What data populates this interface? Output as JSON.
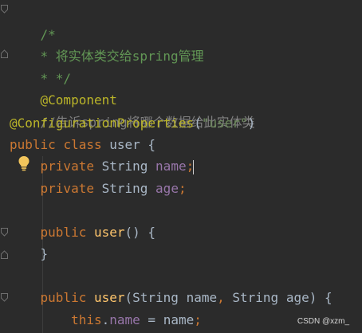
{
  "code": {
    "lines": [
      {
        "slash_star": "/*"
      },
      {
        "doc_line": "* 将实体类交给spring管理"
      },
      {
        "doc_end": "* */"
      },
      {
        "annotation": "@Component"
      },
      {
        "line_comment": "//告诉spring将哪个数据给此实体类"
      },
      {
        "annotation": "@ConfigurationProperties",
        "paren_open": "(",
        "string": "\"user\"",
        "paren_close": ")"
      },
      {
        "kw_public": "public",
        "kw_class": "class",
        "name": "user",
        "brace": "{"
      },
      {
        "kw_private": "private",
        "type": "String",
        "field": "name",
        "semi": ";"
      },
      {
        "kw_private": "private",
        "type": "String",
        "field": "age",
        "semi": ";"
      },
      {},
      {
        "kw_public": "public",
        "method": "user",
        "parens": "()",
        "brace": "{"
      },
      {
        "brace": "}"
      },
      {},
      {
        "kw_public": "public",
        "method": "user",
        "paren_open": "(",
        "type1": "String",
        "param1": "name",
        "comma": ",",
        "type2": "String",
        "param2": "age",
        "paren_close": ")",
        "brace": "{"
      },
      {
        "kw_this": "this",
        "dot": ".",
        "field": "name",
        "eq": "=",
        "value": "name",
        "semi": ";"
      }
    ]
  },
  "watermark": {
    "text": "CSDN @xzm_"
  },
  "colors": {
    "background": "#2b2b2b",
    "keyword": "#cc7832",
    "doc_comment": "#629755",
    "line_comment": "#808080",
    "annotation": "#bbb529",
    "string": "#6a8759",
    "field": "#9876aa",
    "method": "#ffc66d",
    "plain": "#a9b7c6"
  },
  "icons": [
    "fold-marker-icon",
    "intention-bulb-icon"
  ]
}
